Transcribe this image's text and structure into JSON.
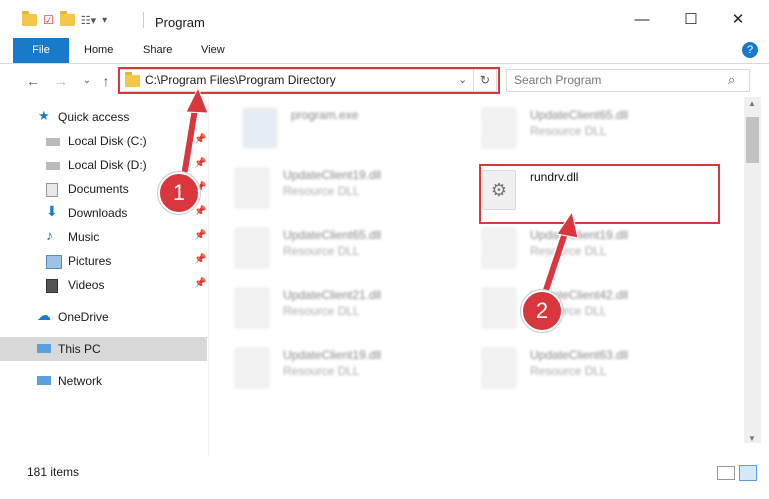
{
  "window": {
    "title": "Program"
  },
  "ribbon": {
    "tabs": [
      "File",
      "Home",
      "Share",
      "View"
    ]
  },
  "address": {
    "path": "C:\\Program Files\\Program Directory"
  },
  "search": {
    "placeholder": "Search Program"
  },
  "sidebar": {
    "items": [
      {
        "label": "Quick access"
      },
      {
        "label": "Local Disk (C:)"
      },
      {
        "label": "Local Disk (D:)"
      },
      {
        "label": "Documents"
      },
      {
        "label": "Downloads"
      },
      {
        "label": "Music"
      },
      {
        "label": "Pictures"
      },
      {
        "label": "Videos"
      },
      {
        "label": "OneDrive"
      },
      {
        "label": "This PC"
      },
      {
        "label": "Network"
      }
    ]
  },
  "files": {
    "left": [
      {
        "name": "program.exe",
        "type": ""
      },
      {
        "name": "UpdateClient19.dll",
        "type": "Resource DLL"
      },
      {
        "name": "UpdateClient65.dll",
        "type": "Resource DLL"
      },
      {
        "name": "UpdateClient21.dll",
        "type": "Resource DLL"
      },
      {
        "name": "UpdateClient19.dll",
        "type": "Resource DLL"
      }
    ],
    "right": [
      {
        "name": "UpdateClient65.dll",
        "type": "Resource DLL"
      },
      {
        "name": "rundrv.dll",
        "type": ""
      },
      {
        "name": "UpdateClient19.dll",
        "type": "Resource DLL"
      },
      {
        "name": "UpdateClient42.dll",
        "type": "Resource DLL"
      },
      {
        "name": "UpdateClient63.dll",
        "type": "Resource DLL"
      }
    ]
  },
  "status": {
    "count": "181 items"
  },
  "annotations": {
    "step1": "1",
    "step2": "2"
  },
  "colors": {
    "accent": "#1979ca",
    "highlight": "#d9363e"
  }
}
